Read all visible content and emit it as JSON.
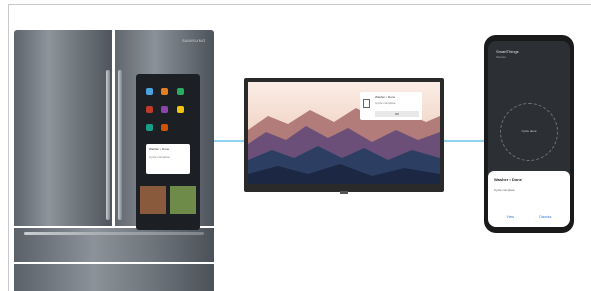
{
  "colors": {
    "background": "#ffffff",
    "connector": "#8fd3f0",
    "frame_line": "#c9c9c9",
    "stainless_mid": "#8d949b",
    "stainless_dark": "#4f555c",
    "screen_dark": "#1c1f24",
    "tv_sky": "#f3dcd2",
    "mountain_back": "#b27c7a",
    "mountain_mid": "#6c4f78",
    "mountain_front": "#2c3f63",
    "phone_body": "#1a1a1a",
    "phone_screen": "#2c2f33",
    "phone_accent": "#3a7bd5"
  },
  "fridge": {
    "brand": "SAMSUNG",
    "screen_popup": {
      "line1": "Washer • Done",
      "line2": "Cycle complete"
    },
    "icon": "family-hub-refrigerator-icon"
  },
  "tv": {
    "notification": {
      "title": "Washer • Done",
      "message": "Cycle complete",
      "button": "OK"
    },
    "icon": "smart-tv-icon"
  },
  "phone": {
    "app_title": "SmartThings",
    "app_subtitle": "Washer",
    "dial_label": "Cycle done",
    "sheet": {
      "title": "Washer • Done",
      "message": "Cycle complete",
      "actions": [
        "View",
        "Dismiss"
      ]
    },
    "icon": "smartphone-icon"
  }
}
